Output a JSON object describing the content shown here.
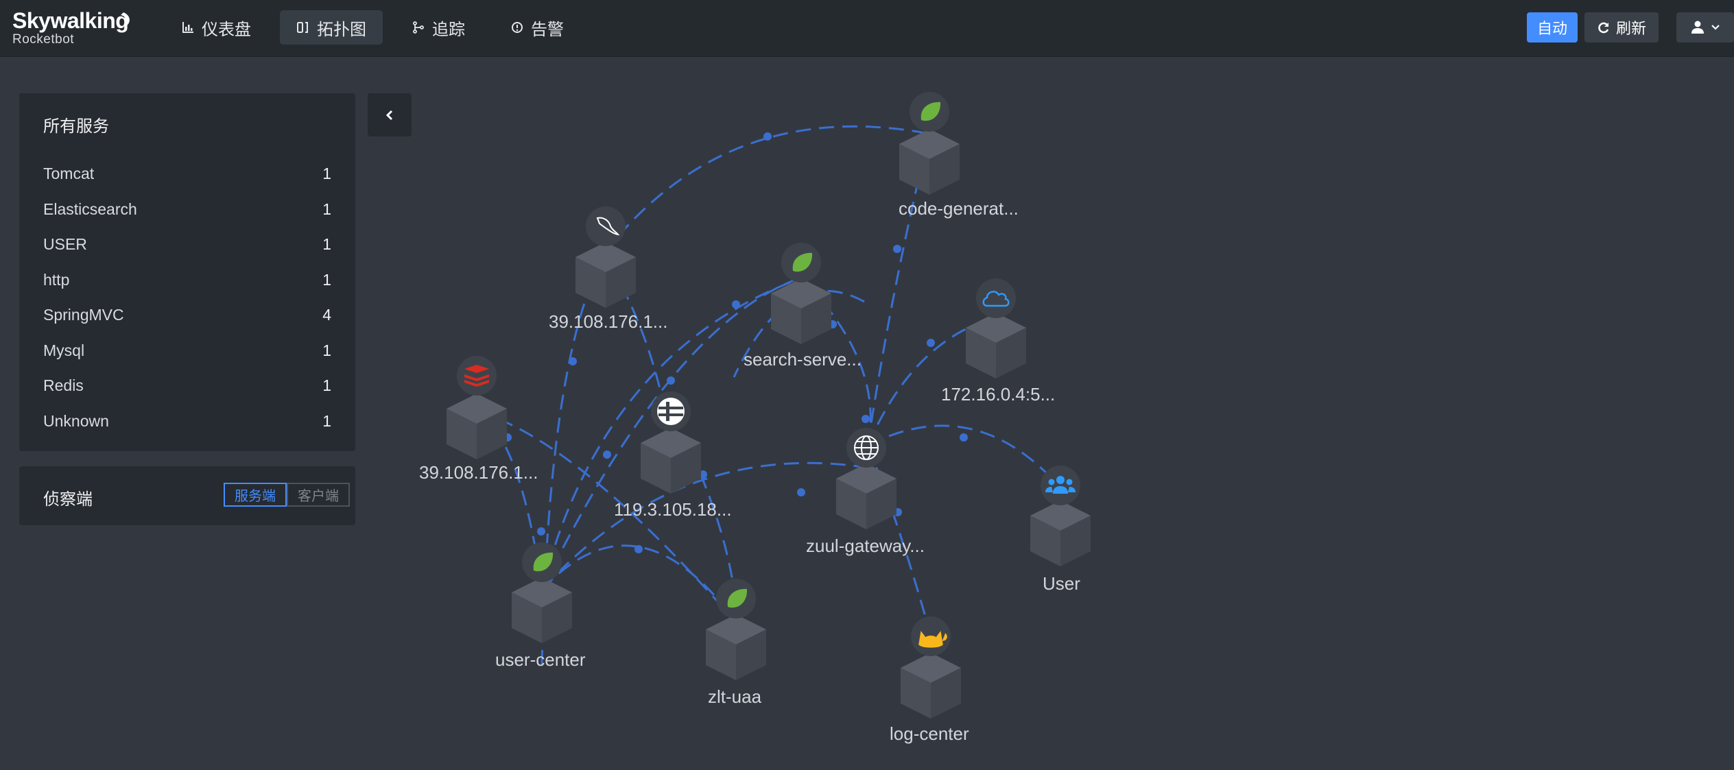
{
  "header": {
    "brand": "Skywalking",
    "sub_brand": "Rocketbot",
    "nav": [
      {
        "label": "仪表盘",
        "icon": "chart-icon"
      },
      {
        "label": "拓扑图",
        "icon": "topology-icon",
        "active": true
      },
      {
        "label": "追踪",
        "icon": "branch-icon"
      },
      {
        "label": "告警",
        "icon": "alert-icon"
      }
    ],
    "auto_label": "自动",
    "refresh_label": "刷新"
  },
  "services_panel": {
    "title": "所有服务",
    "items": [
      {
        "name": "Tomcat",
        "count": "1"
      },
      {
        "name": "Elasticsearch",
        "count": "1"
      },
      {
        "name": "USER",
        "count": "1"
      },
      {
        "name": "http",
        "count": "1"
      },
      {
        "name": "SpringMVC",
        "count": "4"
      },
      {
        "name": "Mysql",
        "count": "1"
      },
      {
        "name": "Redis",
        "count": "1"
      },
      {
        "name": "Unknown",
        "count": "1"
      }
    ]
  },
  "detector_panel": {
    "title": "侦察端",
    "server_label": "服务端",
    "client_label": "客户端"
  },
  "colors": {
    "accent": "#448dfe",
    "edge": "#3a6fd0",
    "cube_top": "#5b606a",
    "spring": "#6db33f",
    "redis": "#d82c20",
    "tomcat": "#f8b81c",
    "cloud": "#2f9bff"
  },
  "topology": {
    "nodes": [
      {
        "id": "code-gen",
        "label": "code-generat...",
        "icon": "spring-leaf-icon"
      },
      {
        "id": "mysql",
        "label": "39.108.176.1...",
        "icon": "mysql-dolphin-icon"
      },
      {
        "id": "search",
        "label": "search-serve...",
        "icon": "spring-leaf-icon"
      },
      {
        "id": "cloud",
        "label": "172.16.0.4:5...",
        "icon": "cloud-icon"
      },
      {
        "id": "redis",
        "label": "39.108.176.1...",
        "icon": "redis-icon"
      },
      {
        "id": "es",
        "label": "119.3.105.18...",
        "icon": "elasticsearch-icon"
      },
      {
        "id": "zuul",
        "label": "zuul-gateway...",
        "icon": "globe-icon"
      },
      {
        "id": "user",
        "label": "User",
        "icon": "users-icon"
      },
      {
        "id": "user-center",
        "label": "user-center",
        "icon": "spring-leaf-icon"
      },
      {
        "id": "uaa",
        "label": "zlt-uaa",
        "icon": "spring-leaf-icon"
      },
      {
        "id": "log",
        "label": "log-center",
        "icon": "tomcat-icon"
      }
    ]
  }
}
